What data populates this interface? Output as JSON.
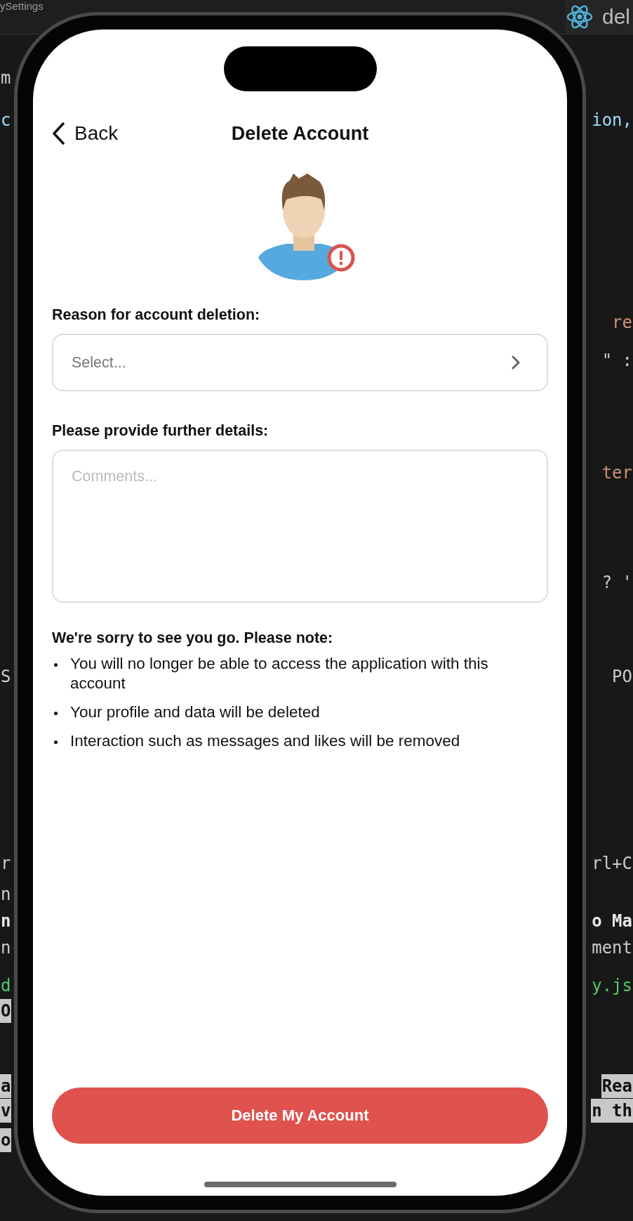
{
  "editor": {
    "tabs": [
      {
        "label": "ySettings",
        "selected": false
      },
      {
        "label": "del",
        "selected": true
      }
    ],
    "lines": [
      {
        "left": "m",
        "kind": "plain"
      },
      {
        "left": "c",
        "right": "ion,",
        "kind": "identifier"
      },
      {
        "right": "re",
        "kind": "string"
      },
      {
        "right": "\" :",
        "kind": "plain"
      },
      {
        "right": "ter",
        "kind": "string"
      },
      {
        "right": "? '",
        "kind": "plain"
      },
      {
        "left": "S",
        "right": "PO",
        "kind": "plain"
      },
      {
        "left": "r",
        "right": "rl+C",
        "kind": "plain"
      },
      {
        "left": "n",
        "kind": "plain"
      },
      {
        "left": "n",
        "right": "o Ma",
        "kind": "heading"
      },
      {
        "left": "n",
        "right": "ment",
        "kind": "plain"
      },
      {
        "left": "d",
        "right": "y.js",
        "kind": "green"
      },
      {
        "left": "O",
        "kind": "highlight"
      },
      {
        "left": "a",
        "right": "Rea",
        "kind": "highlight"
      },
      {
        "left": "v",
        "right": "n th",
        "kind": "highlight"
      },
      {
        "left": "o",
        "kind": "highlight"
      }
    ]
  },
  "screen": {
    "nav": {
      "back": "Back",
      "title": "Delete Account"
    },
    "reason": {
      "label": "Reason for account deletion:",
      "placeholder": "Select..."
    },
    "details": {
      "label": "Please provide further details:",
      "placeholder": "Comments..."
    },
    "note": {
      "heading": "We're sorry to see you go. Please note:",
      "items": [
        "You will no longer be able to access the application with this account",
        "Your profile and data will be deleted",
        "Interaction such as messages and likes will be removed"
      ]
    },
    "button": "Delete My Account"
  }
}
